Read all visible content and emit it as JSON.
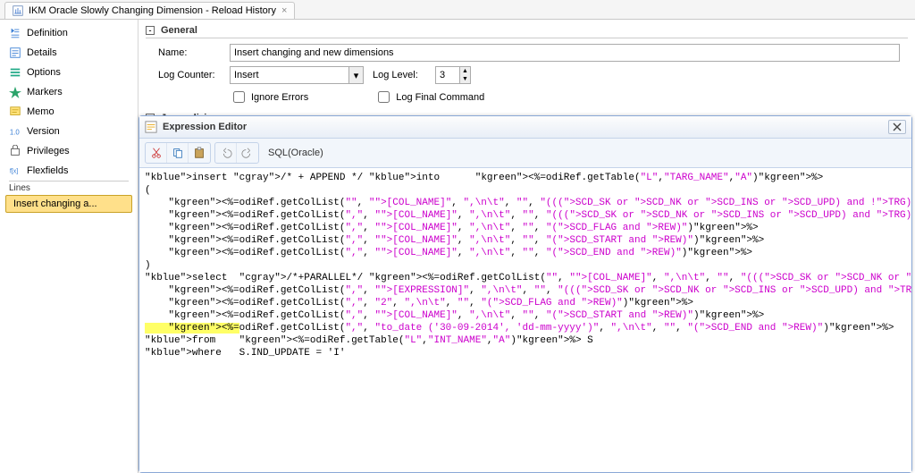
{
  "tab": {
    "title": "IKM Oracle Slowly Changing Dimension - Reload History",
    "close_glyph": "×"
  },
  "sidebar": {
    "items": [
      {
        "label": "Definition",
        "name": "sidebar-definition"
      },
      {
        "label": "Details",
        "name": "sidebar-details"
      },
      {
        "label": "Options",
        "name": "sidebar-options"
      },
      {
        "label": "Markers",
        "name": "sidebar-markers"
      },
      {
        "label": "Memo",
        "name": "sidebar-memo"
      },
      {
        "label": "Version",
        "name": "sidebar-version"
      },
      {
        "label": "Privileges",
        "name": "sidebar-privileges"
      },
      {
        "label": "Flexfields",
        "name": "sidebar-flexfields"
      }
    ],
    "section_label": "Lines",
    "selected": "Insert changing a..."
  },
  "general": {
    "header": "General",
    "name_label": "Name:",
    "name_value": "Insert changing and new dimensions",
    "log_counter_label": "Log Counter:",
    "log_counter_value": "Insert",
    "log_level_label": "Log Level:",
    "log_level_value": "3",
    "ignore_errors_label": "Ignore Errors",
    "log_final_label": "Log Final Command"
  },
  "journalizing": {
    "header": "Journalizing"
  },
  "editor": {
    "title": "Expression Editor",
    "dialect": "SQL(Oracle)",
    "code_lines": [
      {
        "t": "keyword",
        "txt": "insert /* + APPEND */ into      <%=odiRef.getTable(\"L\",\"TARG_NAME\",\"A\")%>"
      },
      {
        "t": "plain",
        "txt": "("
      },
      {
        "t": "col",
        "txt": "    <%=odiRef.getColList(\"\", \"[COL_NAME]\", \",\\n\\t\", \"\", \"(((SCD_SK or SCD_NK or SCD_INS or SCD_UPD) and !TRG) and REW)\")%>"
      },
      {
        "t": "col",
        "txt": "    <%=odiRef.getColList(\",\", \"[COL_NAME]\", \",\\n\\t\", \"\", \"(((SCD_SK or SCD_NK or SCD_INS or SCD_UPD) and TRG) and REW)\")%>"
      },
      {
        "t": "col",
        "txt": "    <%=odiRef.getColList(\",\", \"[COL_NAME]\", \",\\n\\t\", \"\", \"(SCD_FLAG and REW)\")%>"
      },
      {
        "t": "col",
        "txt": "    <%=odiRef.getColList(\",\", \"[COL_NAME]\", \",\\n\\t\", \"\", \"(SCD_START and REW)\")%>"
      },
      {
        "t": "col",
        "txt": "    <%=odiRef.getColList(\",\", \"[COL_NAME]\", \",\\n\\t\", \"\", \"(SCD_END and REW)\")%>"
      },
      {
        "t": "plain",
        "txt": ")"
      },
      {
        "t": "select",
        "txt": "select  /*+PARALLEL*/ <%=odiRef.getColList(\"\", \"[COL_NAME]\", \",\\n\\t\", \"\", \"(((SCD_SK or SCD_NK or SCD_INS or SCD_UPD) and !TRG) and REW)\")%>"
      },
      {
        "t": "col",
        "txt": "    <%=odiRef.getColList(\",\", \"[EXPRESSION]\", \",\\n\\t\", \"\", \"(((SCD_SK or SCD_NK or SCD_INS or SCD_UPD) and TRG) and REW)\")%>"
      },
      {
        "t": "col",
        "txt": "    <%=odiRef.getColList(\",\", \"2\", \",\\n\\t\", \"\", \"(SCD_FLAG and REW)\")%>"
      },
      {
        "t": "col",
        "txt": "    <%=odiRef.getColList(\",\", \"[COL_NAME]\", \",\\n\\t\", \"\", \"(SCD_START and REW)\")%>"
      },
      {
        "t": "hl",
        "txt": "    <%=odiRef.getColList(\",\", \"to_date ('30-09-2014', 'dd-mm-yyyy')\", \",\\n\\t\", \"\", \"(SCD_END and REW)\")%>"
      },
      {
        "t": "from",
        "txt": "from    <%=odiRef.getTable(\"L\",\"INT_NAME\",\"A\")%> S"
      },
      {
        "t": "where",
        "txt": "where   S.IND_UPDATE = 'I'"
      }
    ]
  }
}
